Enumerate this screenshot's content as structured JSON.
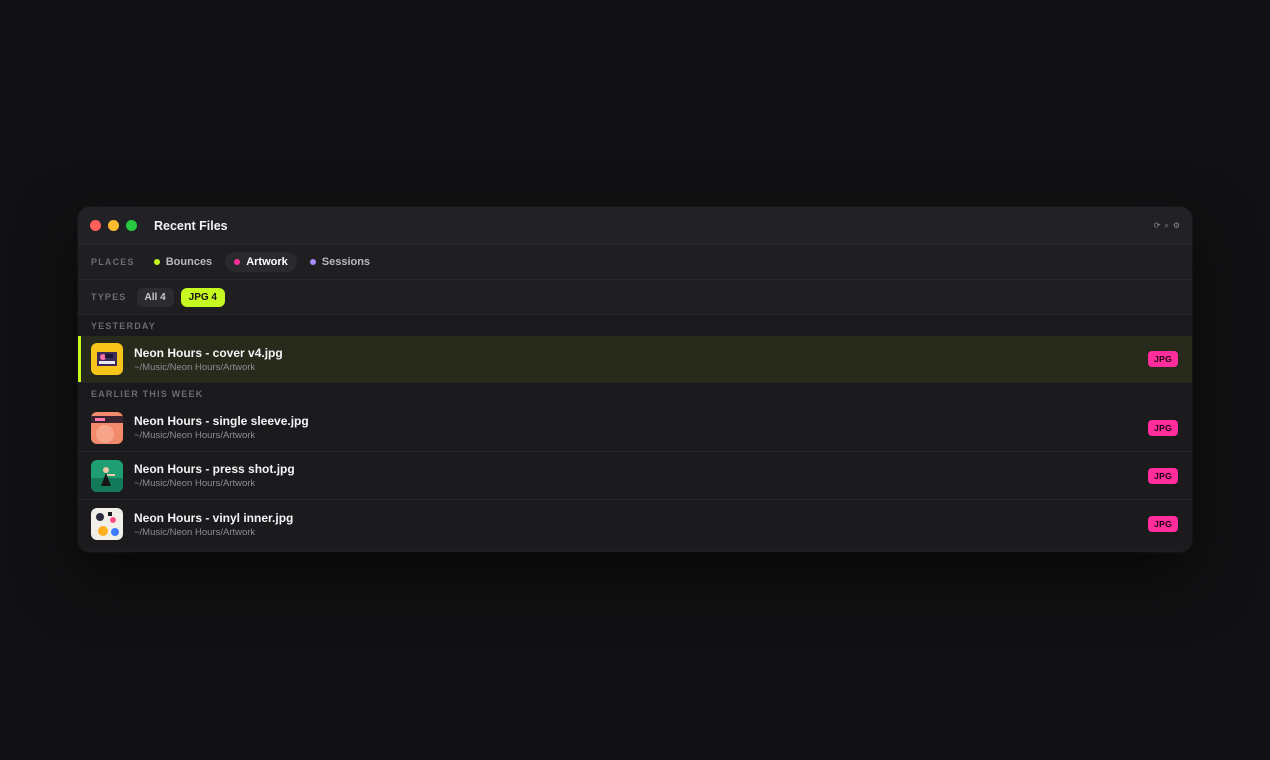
{
  "window": {
    "title": "Recent Files",
    "toolbar_icons": [
      "refresh-icon",
      "search-icon",
      "settings-icon"
    ]
  },
  "places": {
    "label": "PLACES",
    "items": [
      {
        "label": "Bounces",
        "color": "#c6f91f",
        "active": false
      },
      {
        "label": "Artwork",
        "color": "#ff2d9b",
        "active": true
      },
      {
        "label": "Sessions",
        "color": "#a78bfa",
        "active": false
      }
    ]
  },
  "types": {
    "label": "TYPES",
    "chips": [
      {
        "label": "All 4",
        "active": false
      },
      {
        "label": "JPG 4",
        "active": true
      }
    ]
  },
  "sections": [
    {
      "label": "YESTERDAY",
      "files": [
        {
          "name": "Neon Hours - cover v4.jpg",
          "path": "~/Music/Neon Hours/Artwork",
          "type": "JPG",
          "selected": true,
          "thumb": "cover-artwork-thumbnail"
        }
      ]
    },
    {
      "label": "EARLIER THIS WEEK",
      "files": [
        {
          "name": "Neon Hours - single sleeve.jpg",
          "path": "~/Music/Neon Hours/Artwork",
          "type": "JPG",
          "selected": false,
          "thumb": "sleeve-artwork-thumbnail"
        },
        {
          "name": "Neon Hours - press shot.jpg",
          "path": "~/Music/Neon Hours/Artwork",
          "type": "JPG",
          "selected": false,
          "thumb": "press-shot-thumbnail"
        },
        {
          "name": "Neon Hours - vinyl inner.jpg",
          "path": "~/Music/Neon Hours/Artwork",
          "type": "JPG",
          "selected": false,
          "thumb": "vinyl-inner-thumbnail"
        }
      ]
    }
  ],
  "colors": {
    "accent": "#c6f91f",
    "badge": "#ff2d9b"
  }
}
